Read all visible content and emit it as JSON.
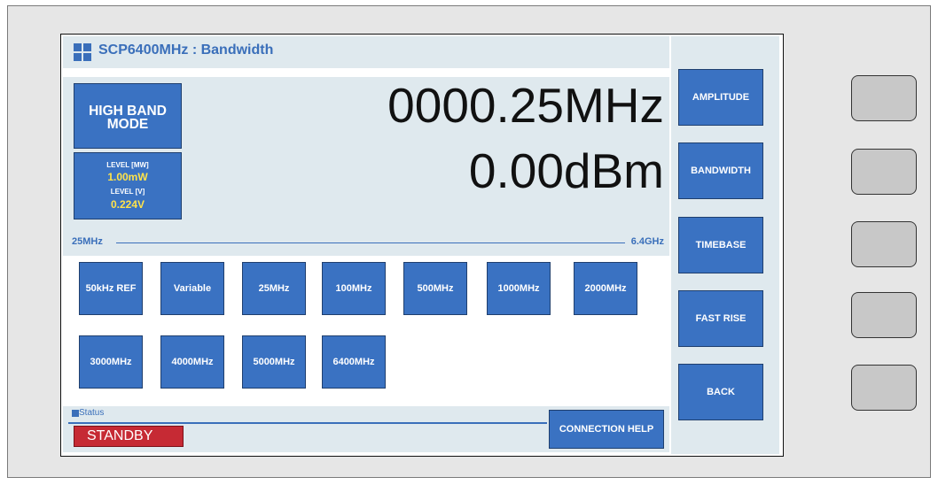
{
  "window": {
    "title": "SCP6400MHz : Bandwidth"
  },
  "mode_button": {
    "line1": "HIGH BAND",
    "line2": "MODE"
  },
  "levels": {
    "mw_label": "LEVEL [MW]",
    "mw_value": "1.00mW",
    "v_label": "LEVEL [V]",
    "v_value": "0.224V"
  },
  "readout": {
    "frequency": "0000.25MHz",
    "power": "0.00dBm"
  },
  "range": {
    "min": "25MHz",
    "max": "6.4GHz"
  },
  "presets": [
    "50kHz REF",
    "Variable",
    "25MHz",
    "100MHz",
    "500MHz",
    "1000MHz",
    "2000MHz",
    "3000MHz",
    "4000MHz",
    "5000MHz",
    "6400MHz"
  ],
  "status": {
    "label": "Status",
    "state": "STANDBY",
    "connection_help": "CONNECTION HELP"
  },
  "softkeys": [
    "AMPLITUDE",
    "BANDWIDTH",
    "TIMEBASE",
    "FAST RISE",
    "BACK"
  ],
  "colors": {
    "accent": "#3a72c2",
    "panel_bg": "#dfe9ee",
    "standby": "#c62a34",
    "level_value": "#ffe34a"
  }
}
